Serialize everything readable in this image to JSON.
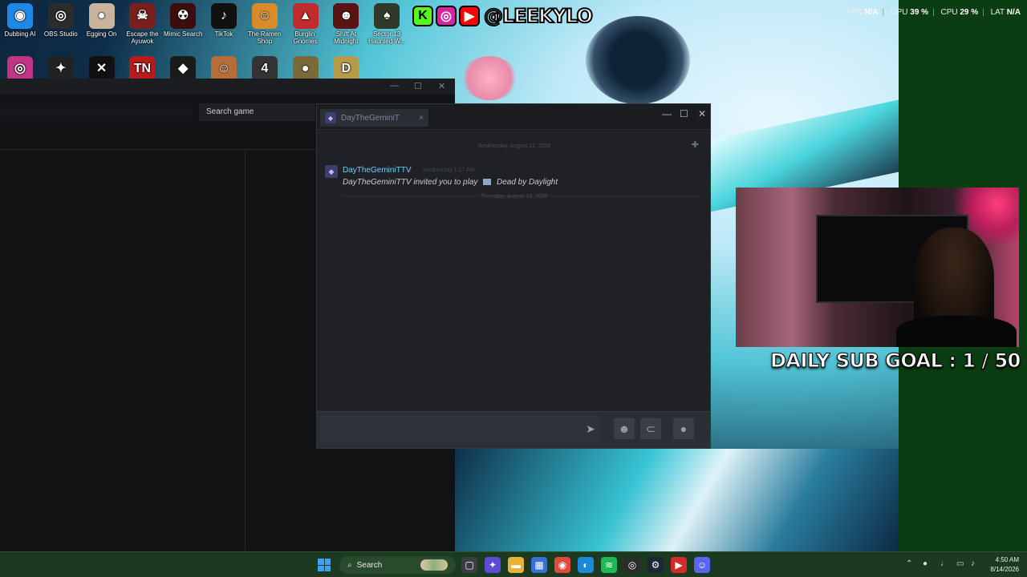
{
  "desktop": {
    "icons_row1": [
      {
        "label": "Dubbing AI",
        "icon": "dubbing-ai-icon",
        "color": "#1e88e5",
        "glyph": "◉"
      },
      {
        "label": "OBS Studio",
        "icon": "obs-studio-icon",
        "color": "#2b2b2b",
        "glyph": "◎"
      },
      {
        "label": "Egging On",
        "icon": "egg-icon",
        "color": "#c9b39b",
        "glyph": "●"
      },
      {
        "label": "Escape the Ayuwok",
        "icon": "escape-the-ayuwok-icon",
        "color": "#7a1f1f",
        "glyph": "☠"
      },
      {
        "label": "Mimic Search",
        "icon": "mimic-search-icon",
        "color": "#3b0d0d",
        "glyph": "☢"
      },
      {
        "label": "TikTok",
        "icon": "tiktok-icon",
        "color": "#111111",
        "glyph": "♪"
      },
      {
        "label": "The Ramen Shop",
        "icon": "ramen-shop-icon",
        "color": "#d98a2b",
        "glyph": "☺"
      },
      {
        "label": "Burglin' Gnomes",
        "icon": "burglin-gnomes-icon",
        "color": "#c22b2b",
        "glyph": "▲"
      },
      {
        "label": "Shift At Midnight",
        "icon": "shift-at-midnight-icon",
        "color": "#5a1414",
        "glyph": "☻"
      },
      {
        "label": "Sector 13 Haunted W...",
        "icon": "sector-13-icon",
        "color": "#2f3a2a",
        "glyph": "♠"
      }
    ],
    "icons_row2": [
      {
        "icon": "instagram-icon",
        "color": "#c13584",
        "glyph": "◎"
      },
      {
        "icon": "wolf-app-icon",
        "color": "#222222",
        "glyph": "✦"
      },
      {
        "icon": "capcut-icon",
        "color": "#111111",
        "glyph": "✕"
      },
      {
        "icon": "tn-icon",
        "color": "#b71c1c",
        "glyph": "TN"
      },
      {
        "icon": "dark-game-icon",
        "color": "#1b1b1b",
        "glyph": "◆"
      },
      {
        "icon": "character-game-icon",
        "color": "#b76d3a",
        "glyph": "☺"
      },
      {
        "icon": "speed-game-icon",
        "color": "#333333",
        "glyph": "4"
      },
      {
        "icon": "gold-game-icon",
        "color": "#7a6a3a",
        "glyph": "●"
      },
      {
        "icon": "d-app-icon",
        "color": "#b59b4a",
        "glyph": "D"
      }
    ]
  },
  "brand": {
    "k": "K",
    "handle": "@LEEKYLO"
  },
  "stats": {
    "fps_label": "FPS",
    "fps_value": "N/A",
    "gpu_label": "GPU",
    "gpu_value": "39 %",
    "cpu_label": "CPU",
    "cpu_value": "29 %",
    "lat_label": "LAT",
    "lat_value": "N/A"
  },
  "left_window": {
    "search_label": "Search game"
  },
  "chat": {
    "tab_name": "DayTheGeminiT",
    "tab_close": "×",
    "window_controls": {
      "minimize": "—",
      "maximize": "☐",
      "close": "✕"
    },
    "day1": "Wednesday, August 12, 2026",
    "day2": "Thursday, August 13, 2026",
    "message": {
      "sender": "DayTheGeminiTTV",
      "time": "Wednesday 1:17 AM",
      "text_prefix": "DayTheGeminiTTV invited you to play",
      "game": "Dead by Daylight"
    }
  },
  "overlay": {
    "sub_goal": "DAILY SUB GOAL : 1 / 50"
  },
  "taskbar": {
    "search_label": "Search",
    "clock_time": "4:50 AM",
    "clock_date": "8/14/2026"
  },
  "colors": {
    "accent": "#6dcff6",
    "taskbar": "#1b3a1f"
  }
}
